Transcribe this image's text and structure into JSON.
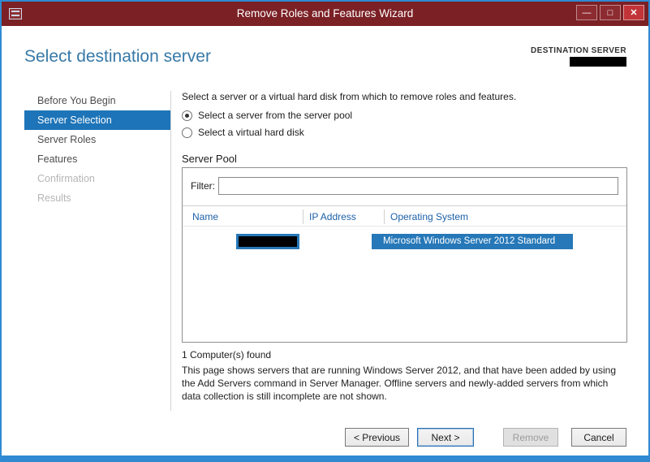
{
  "window": {
    "title": "Remove Roles and Features Wizard",
    "controls": {
      "minimize": "—",
      "maximize": "□",
      "close": "✕"
    }
  },
  "header": {
    "title": "Select destination server",
    "destination_label": "DESTINATION SERVER",
    "destination_server_name_redacted": true
  },
  "sidebar": {
    "items": [
      {
        "label": "Before You Begin",
        "state": "enabled"
      },
      {
        "label": "Server Selection",
        "state": "selected"
      },
      {
        "label": "Server Roles",
        "state": "enabled"
      },
      {
        "label": "Features",
        "state": "enabled"
      },
      {
        "label": "Confirmation",
        "state": "disabled"
      },
      {
        "label": "Results",
        "state": "disabled"
      }
    ]
  },
  "main": {
    "intro": "Select a server or a virtual hard disk from which to remove roles and features.",
    "radio_server_pool": "Select a server from the server pool",
    "radio_vhd": "Select a virtual hard disk",
    "radio_selected": "Select a server from the server pool",
    "server_pool_label": "Server Pool",
    "filter_label": "Filter:",
    "filter_value": "",
    "table": {
      "columns": [
        "Name",
        "IP Address",
        "Operating System"
      ],
      "rows": [
        {
          "name_redacted": true,
          "ip": "",
          "os": "Microsoft Windows Server 2012 Standard",
          "selected": true
        }
      ]
    },
    "count_text": "1 Computer(s) found",
    "description": "This page shows servers that are running Windows Server 2012, and that have been added by using the Add Servers command in Server Manager. Offline servers and newly-added servers from which data collection is still incomplete are not shown."
  },
  "footer": {
    "buttons": [
      {
        "label": "< Previous",
        "state": "enabled"
      },
      {
        "label": "Next >",
        "state": "focused"
      },
      {
        "label": "Remove",
        "state": "disabled"
      },
      {
        "label": "Cancel",
        "state": "enabled"
      }
    ]
  },
  "colors": {
    "titlebar": "#7b2025",
    "close_button": "#c13438",
    "window_border": "#2f8ad2",
    "heading": "#3779a8",
    "nav_selected": "#1d74b8",
    "row_selection": "#2678b8",
    "table_header_text": "#1c60a8"
  }
}
